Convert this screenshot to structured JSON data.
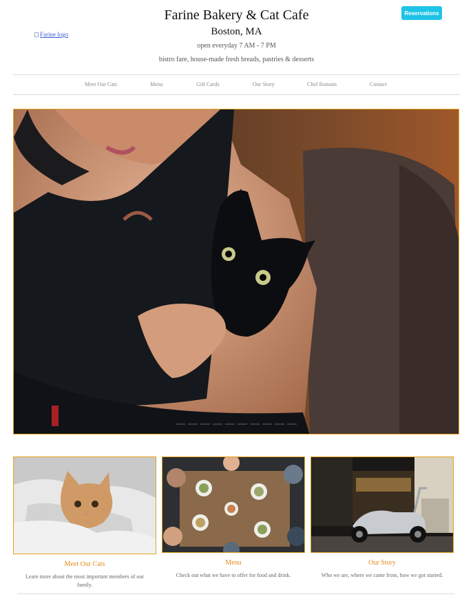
{
  "header": {
    "logo_alt": "Farine logo",
    "title": "Farine Bakery & Cat Cafe",
    "city": "Boston, MA",
    "hours": "open everyday 7 AM - 7 PM",
    "tagline": "bistro fare, house-made fresh breads, pastries & desserts",
    "reservations_label": "Reservations"
  },
  "nav": {
    "items": [
      {
        "label": "Meet Our Cats"
      },
      {
        "label": "Menu"
      },
      {
        "label": "Gift Cards"
      },
      {
        "label": "Our Story"
      },
      {
        "label": "Chef Romain"
      },
      {
        "label": "Contact"
      }
    ]
  },
  "hero": {
    "slide_count": 10,
    "active_slide": 1
  },
  "cards": [
    {
      "title": "Meet Our Cats",
      "desc": "Learn more about the most important members of our family."
    },
    {
      "title": "Menu",
      "desc": "Check out what we have to offer for food and drink."
    },
    {
      "title": "Our Story",
      "desc": "Who we are, where we came from, how we got started."
    }
  ],
  "colors": {
    "accent": "#e6a21a",
    "button": "#1ec3e8",
    "card_title": "#e8881e"
  }
}
